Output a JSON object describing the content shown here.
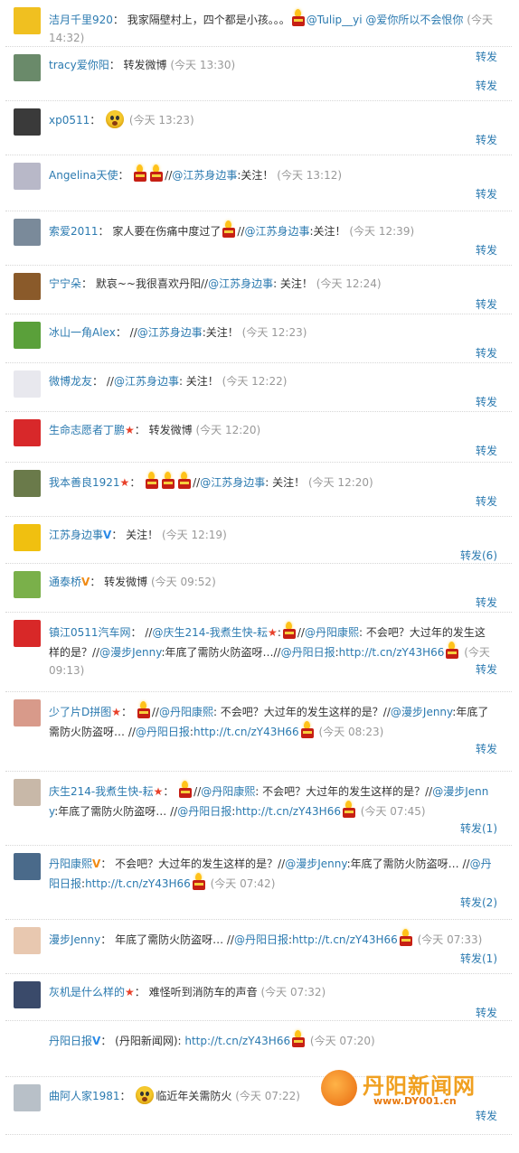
{
  "repost_label": "转发",
  "posts": [
    {
      "user": "洁月千里920",
      "parts": [
        {
          "t": "text",
          "v": "我家隔壁村上，四个都是小孩。。。"
        },
        {
          "t": "candle"
        },
        {
          "t": "link",
          "v": "@Tulip__yi"
        },
        {
          "t": "text",
          "v": " "
        },
        {
          "t": "link",
          "v": "@爱你所以不会恨你"
        }
      ],
      "time": "(今天 14:32)",
      "repost": "转发",
      "avatar_color": "#f0c020"
    },
    {
      "user": "tracy爱你阳",
      "parts": [
        {
          "t": "text",
          "v": "转发微博"
        }
      ],
      "time": "(今天 13:30)",
      "repost": "转发",
      "avatar_color": "#6a8a6a"
    },
    {
      "user": "xp0511",
      "parts": [
        {
          "t": "emoji"
        }
      ],
      "time": "(今天 13:23)",
      "repost": "转发",
      "avatar_color": "#3a3a3a"
    },
    {
      "user": "Angelina天使",
      "parts": [
        {
          "t": "candle"
        },
        {
          "t": "candle"
        },
        {
          "t": "text",
          "v": "//"
        },
        {
          "t": "link",
          "v": "@江苏身边事"
        },
        {
          "t": "text",
          "v": ":关注！"
        }
      ],
      "time": "(今天 13:12)",
      "repost": "转发",
      "avatar_color": "#b8b8c8"
    },
    {
      "user": "索爱2011",
      "parts": [
        {
          "t": "text",
          "v": "家人要在伤痛中度过了"
        },
        {
          "t": "candle"
        },
        {
          "t": "text",
          "v": "//"
        },
        {
          "t": "link",
          "v": "@江苏身边事"
        },
        {
          "t": "text",
          "v": ":关注！"
        }
      ],
      "time": "(今天 12:39)",
      "repost": "转发",
      "avatar_color": "#7a8a9a"
    },
    {
      "user": "宁宁朵",
      "parts": [
        {
          "t": "text",
          "v": "默哀~~我很喜欢丹阳"
        },
        {
          "t": "text",
          "v": "//"
        },
        {
          "t": "link",
          "v": "@江苏身边事"
        },
        {
          "t": "text",
          "v": ": 关注！"
        }
      ],
      "time": "(今天 12:24)",
      "repost": "转发",
      "avatar_color": "#8a5a2a"
    },
    {
      "user": "冰山一角Alex",
      "parts": [
        {
          "t": "text",
          "v": "//"
        },
        {
          "t": "link",
          "v": "@江苏身边事"
        },
        {
          "t": "text",
          "v": ":关注！"
        }
      ],
      "time": "(今天 12:23)",
      "repost": "转发",
      "avatar_color": "#5aa03a"
    },
    {
      "user": "微博龙友",
      "parts": [
        {
          "t": "text",
          "v": "//"
        },
        {
          "t": "link",
          "v": "@江苏身边事"
        },
        {
          "t": "text",
          "v": ": 关注！"
        }
      ],
      "time": "(今天 12:22)",
      "repost": "转发",
      "avatar_color": "#e8e8ee"
    },
    {
      "user": "生命志愿者丁鹏",
      "star": true,
      "parts": [
        {
          "t": "text",
          "v": "转发微博"
        }
      ],
      "time": "(今天 12:20)",
      "repost": "转发",
      "avatar_color": "#d8282a"
    },
    {
      "user": "我本善良1921",
      "star": true,
      "parts": [
        {
          "t": "candle"
        },
        {
          "t": "candle"
        },
        {
          "t": "candle"
        },
        {
          "t": "text",
          "v": "//"
        },
        {
          "t": "link",
          "v": "@江苏身边事"
        },
        {
          "t": "text",
          "v": ": 关注！"
        }
      ],
      "time": "(今天 12:20)",
      "repost": "转发",
      "avatar_color": "#6a7a4a"
    },
    {
      "user": "江苏身边事",
      "v": "blue",
      "parts": [
        {
          "t": "text",
          "v": "关注！"
        }
      ],
      "time": "(今天 12:19)",
      "repost": "转发(6)",
      "avatar_color": "#f0c010"
    },
    {
      "user": "通泰桥",
      "v": "orange",
      "parts": [
        {
          "t": "text",
          "v": "转发微博"
        }
      ],
      "time": "(今天 09:52)",
      "repost": "转发",
      "avatar_color": "#7ab04a"
    },
    {
      "user": "镇江0511汽车网",
      "parts": [
        {
          "t": "text",
          "v": "//"
        },
        {
          "t": "link",
          "v": "@庆生214-我煮生快-耘"
        },
        {
          "t": "star"
        },
        {
          "t": "text",
          "v": ":"
        },
        {
          "t": "candle"
        },
        {
          "t": "text",
          "v": "//"
        },
        {
          "t": "link",
          "v": "@丹阳康熙"
        },
        {
          "t": "text",
          "v": ": 不会吧？大过年的发生这样的是？//"
        },
        {
          "t": "link",
          "v": "@漫步Jenny"
        },
        {
          "t": "text",
          "v": ":年底了需防火防盗呀…//"
        },
        {
          "t": "link",
          "v": "@丹阳日报"
        },
        {
          "t": "text",
          "v": ":"
        },
        {
          "t": "link",
          "v": "http://t.cn/zY43H66"
        },
        {
          "t": "candle"
        }
      ],
      "time": "(今天 09:13)",
      "repost": "转发",
      "avatar_color": "#d82828"
    },
    {
      "user": "少了片D拼图",
      "star": true,
      "parts": [
        {
          "t": "candle"
        },
        {
          "t": "text",
          "v": "//"
        },
        {
          "t": "link",
          "v": "@丹阳康熙"
        },
        {
          "t": "text",
          "v": ": 不会吧？大过年的发生这样的是？//"
        },
        {
          "t": "link",
          "v": "@漫步Jenny"
        },
        {
          "t": "text",
          "v": ":年底了需防火防盗呀… //"
        },
        {
          "t": "link",
          "v": "@丹阳日报"
        },
        {
          "t": "text",
          "v": ":"
        },
        {
          "t": "link",
          "v": "http://t.cn/zY43H66"
        },
        {
          "t": "candle"
        }
      ],
      "time": "(今天 08:23)",
      "repost": "转发",
      "avatar_color": "#d89a8a"
    },
    {
      "user": "庆生214-我煮生快-耘",
      "star": true,
      "parts": [
        {
          "t": "candle"
        },
        {
          "t": "text",
          "v": "//"
        },
        {
          "t": "link",
          "v": "@丹阳康熙"
        },
        {
          "t": "text",
          "v": ": 不会吧？大过年的发生这样的是？//"
        },
        {
          "t": "link",
          "v": "@漫步Jenny"
        },
        {
          "t": "text",
          "v": ":年底了需防火防盗呀… //"
        },
        {
          "t": "link",
          "v": "@丹阳日报"
        },
        {
          "t": "text",
          "v": ":"
        },
        {
          "t": "link",
          "v": "http://t.cn/zY43H66"
        },
        {
          "t": "candle"
        }
      ],
      "time": "(今天 07:45)",
      "repost": "转发(1)",
      "avatar_color": "#c8b8a8"
    },
    {
      "user": "丹阳康熙",
      "v": "orange",
      "parts": [
        {
          "t": "text",
          "v": "不会吧？大过年的发生这样的是？//"
        },
        {
          "t": "link",
          "v": "@漫步Jenny"
        },
        {
          "t": "text",
          "v": ":年底了需防火防盗呀… //"
        },
        {
          "t": "link",
          "v": "@丹阳日报"
        },
        {
          "t": "text",
          "v": ":"
        },
        {
          "t": "link",
          "v": "http://t.cn/zY43H66"
        },
        {
          "t": "candle"
        }
      ],
      "time": "(今天 07:42)",
      "repost": "转发(2)",
      "avatar_color": "#4a6a8a"
    },
    {
      "user": "漫步Jenny",
      "parts": [
        {
          "t": "text",
          "v": "年底了需防火防盗呀… //"
        },
        {
          "t": "link",
          "v": "@丹阳日报"
        },
        {
          "t": "text",
          "v": ":"
        },
        {
          "t": "link",
          "v": "http://t.cn/zY43H66"
        },
        {
          "t": "candle"
        }
      ],
      "time": "(今天 07:33)",
      "repost": "转发(1)",
      "avatar_color": "#e8c8b0"
    },
    {
      "user": "灰机是什么样的",
      "star": true,
      "parts": [
        {
          "t": "text",
          "v": "难怪听到消防车的声音"
        }
      ],
      "time": "(今天 07:32)",
      "repost": "转发",
      "avatar_color": "#3a4a6a"
    },
    {
      "user": "丹阳日报",
      "v": "blue",
      "parts": [
        {
          "t": "text",
          "v": "(丹阳新闻网): "
        },
        {
          "t": "link",
          "v": "http://t.cn/zY43H66"
        },
        {
          "t": "candle"
        }
      ],
      "time": "(今天 07:20)",
      "repost": "",
      "avatar_color": "#ffffff"
    },
    {
      "user": "曲阿人家1981",
      "parts": [
        {
          "t": "emoji"
        },
        {
          "t": "text",
          "v": "临近年关需防火"
        }
      ],
      "time": "(今天 07:22)",
      "repost": "转发",
      "avatar_color": "#b8c0c8"
    }
  ],
  "watermark": {
    "title": "丹阳新闻网",
    "url": "www.DY001.cn"
  }
}
